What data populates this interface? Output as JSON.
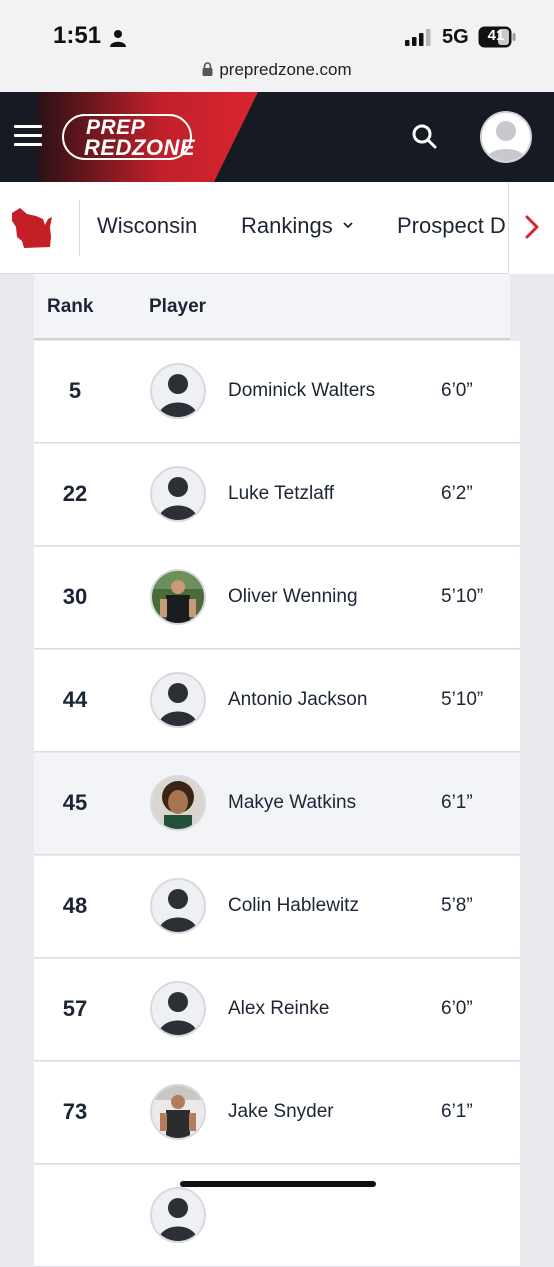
{
  "status_bar": {
    "time": "1:51",
    "network": "5G",
    "battery": "41",
    "url": "prepredzone.com"
  },
  "header": {
    "logo_line1": "PREP",
    "logo_line2": "REDZONE",
    "accent_color": "#d92530"
  },
  "nav": {
    "items": [
      {
        "label": "Wisconsin"
      },
      {
        "label": "Rankings"
      },
      {
        "label": "Prospect D"
      }
    ]
  },
  "table": {
    "columns": [
      "Rank",
      "Player"
    ],
    "rows": [
      {
        "rank": "5",
        "name": "Dominick Walters",
        "height": "6’0”",
        "photo": "placeholder"
      },
      {
        "rank": "22",
        "name": "Luke Tetzlaff",
        "height": "6’2”",
        "photo": "placeholder"
      },
      {
        "rank": "30",
        "name": "Oliver Wenning",
        "height": "5’10”",
        "photo": "photo"
      },
      {
        "rank": "44",
        "name": "Antonio Jackson",
        "height": "5’10”",
        "photo": "placeholder"
      },
      {
        "rank": "45",
        "name": "Makye Watkins",
        "height": "6’1”",
        "photo": "photo"
      },
      {
        "rank": "48",
        "name": "Colin Hablewitz",
        "height": "5’8”",
        "photo": "placeholder"
      },
      {
        "rank": "57",
        "name": "Alex Reinke",
        "height": "6’0”",
        "photo": "placeholder"
      },
      {
        "rank": "73",
        "name": "Jake Snyder",
        "height": "6’1”",
        "photo": "photo"
      }
    ]
  }
}
